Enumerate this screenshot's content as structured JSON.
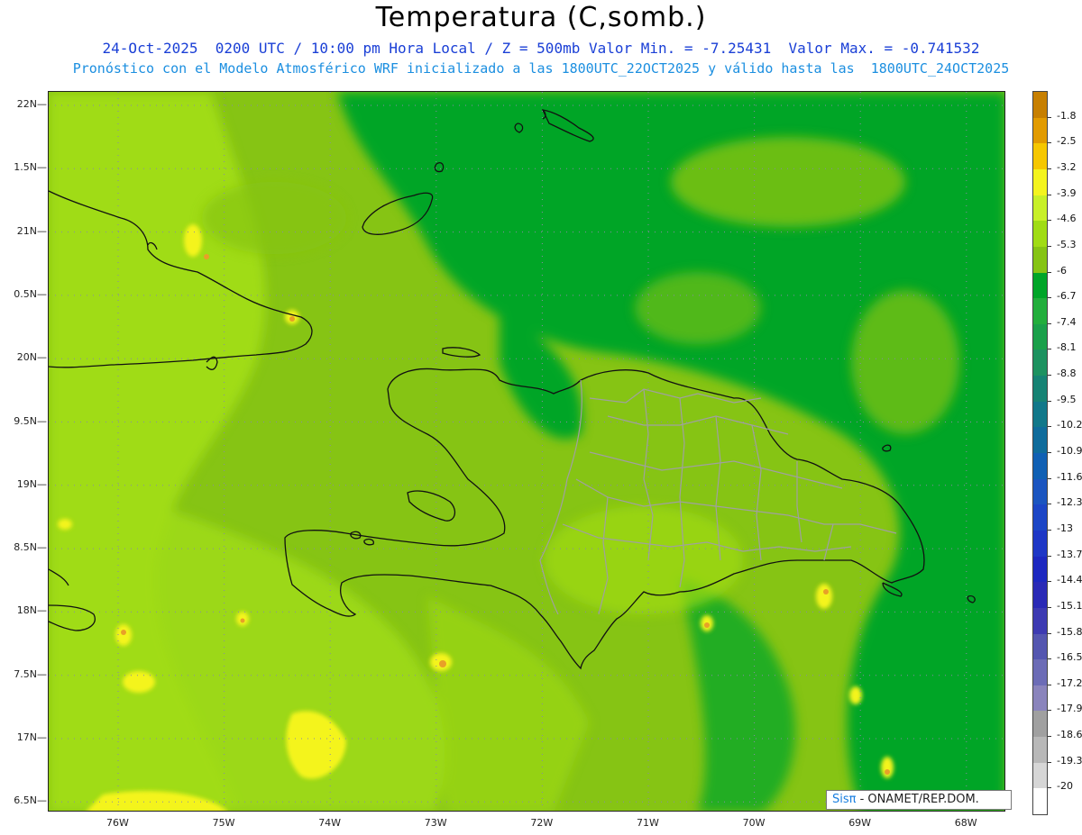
{
  "header": {
    "title": "Temperatura (C,somb.)",
    "line1": "24-Oct-2025  0200 UTC / 10:00 pm Hora Local / Z = 500mb Valor Min. = -7.25431  Valor Max. = -0.741532",
    "line2": "Pronóstico con el Modelo Atmosférico WRF inicializado a las 1800UTC_22OCT2025 y válido hasta las  1800UTC_24OCT2025"
  },
  "map": {
    "lat_labels": [
      "22N",
      "1.5N",
      "21N",
      "0.5N",
      "20N",
      "9.5N",
      "19N",
      "8.5N",
      "18N",
      "7.5N",
      "17N",
      "6.5N"
    ],
    "lon_labels": [
      "76W",
      "75W",
      "74W",
      "73W",
      "72W",
      "71W",
      "70W",
      "69W",
      "68W"
    ],
    "colors": {
      "base_green": "#86c414",
      "light_green": "#a0dc14",
      "dark_green": "#009e1a",
      "yellow": "#f4f41e",
      "orange": "#e8a028",
      "coast": "#111111",
      "borders": "#a0a0a0"
    }
  },
  "colorbar": {
    "labels": [
      "-1.8",
      "-2.5",
      "-3.2",
      "-3.9",
      "-4.6",
      "-5.3",
      "-6",
      "-6.7",
      "-7.4",
      "-8.1",
      "-8.8",
      "-9.5",
      "-10.2",
      "-10.9",
      "-11.6",
      "-12.3",
      "-13",
      "-13.7",
      "-14.4",
      "-15.1",
      "-15.8",
      "-16.5",
      "-17.2",
      "-17.9",
      "-18.6",
      "-19.3",
      "-20"
    ],
    "colors": [
      "#c77f00",
      "#e29b00",
      "#f6c700",
      "#f4f41e",
      "#c8f028",
      "#a0dc14",
      "#86c414",
      "#00a528",
      "#22ae3c",
      "#1aa04a",
      "#1d9260",
      "#168374",
      "#11788a",
      "#0f6c9c",
      "#1060b4",
      "#1b55c0",
      "#1c46c6",
      "#1e37c6",
      "#1d28c0",
      "#2a2ab6",
      "#3d3ab2",
      "#5456b0",
      "#6c6cb6",
      "#8a84bc",
      "#a0a0a0",
      "#b8b8b8",
      "#d6d6d6",
      "#ffffff"
    ]
  },
  "credit": {
    "logo": "Sisπ",
    "text": " - ONAMET/REP.DOM."
  }
}
